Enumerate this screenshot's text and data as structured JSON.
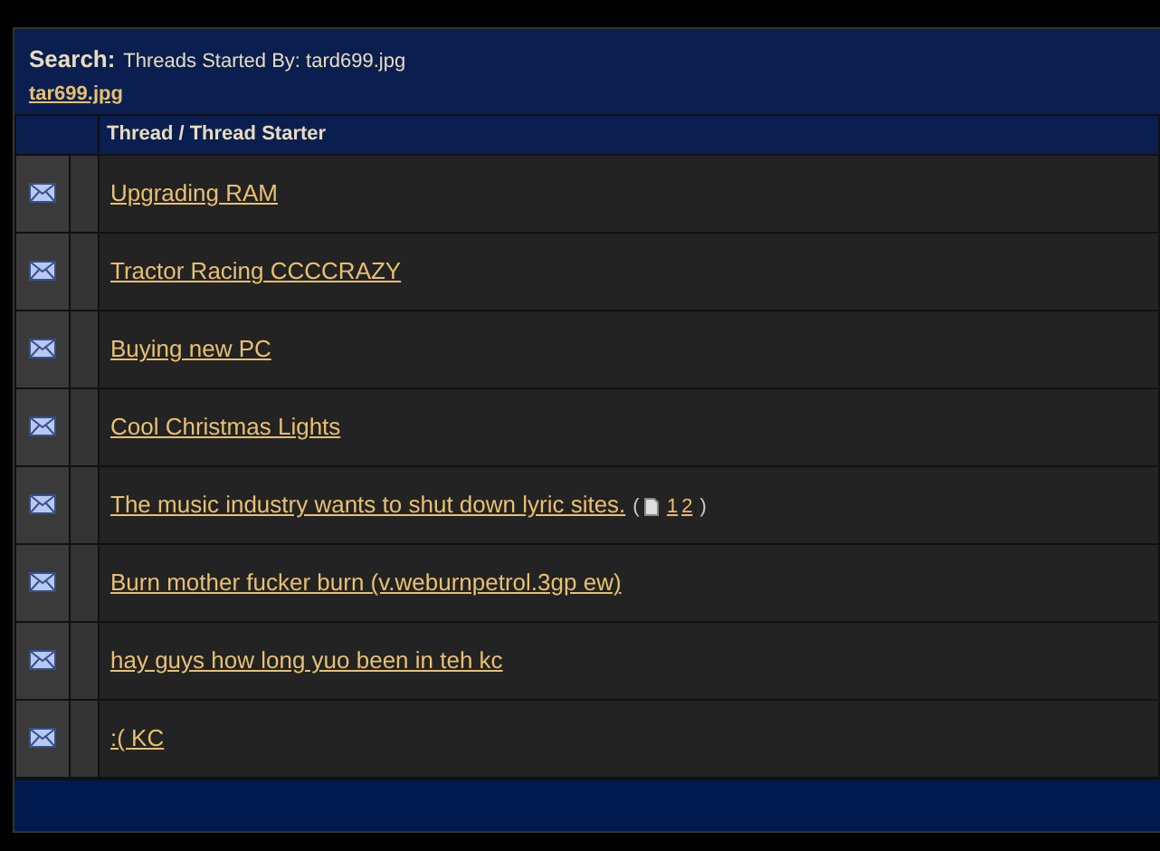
{
  "header": {
    "label": "Search:",
    "description": "Threads Started By: tard699.jpg",
    "user_link": "tar699.jpg"
  },
  "table": {
    "columns": [
      "Thread / Thread Starter"
    ],
    "rows": [
      {
        "title": "Upgrading RAM"
      },
      {
        "title": "Tractor Racing CCCCRAZY"
      },
      {
        "title": "Buying new PC"
      },
      {
        "title": "Cool Christmas Lights"
      },
      {
        "title": "The music industry wants to shut down lyric sites.",
        "pages": {
          "open": "(",
          "numbers": [
            "1",
            "2"
          ],
          "close": ")"
        }
      },
      {
        "title": "Burn mother fucker burn (v.weburnpetrol.3gp ew)"
      },
      {
        "title": "hay guys how long yuo been in teh kc"
      },
      {
        "title": ":( KC"
      }
    ]
  }
}
